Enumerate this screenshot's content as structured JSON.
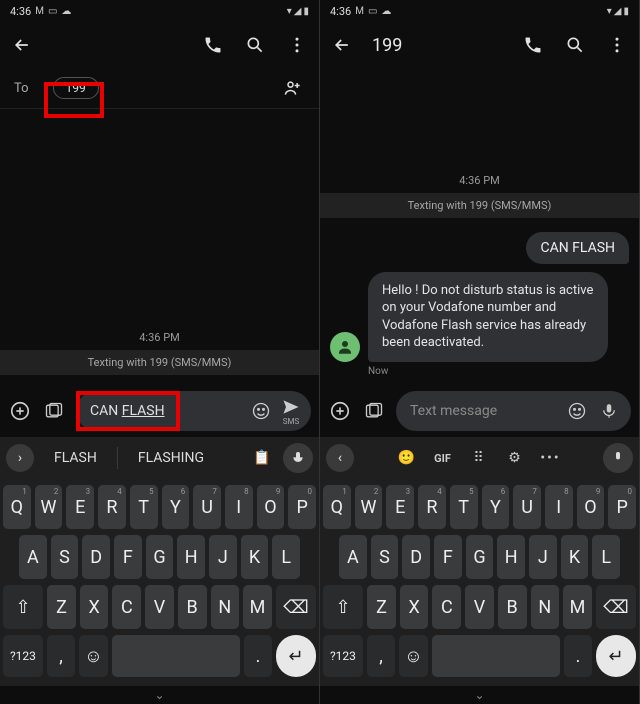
{
  "status": {
    "time": "4:36",
    "icons": [
      "M",
      "▭",
      "☁"
    ],
    "right": [
      "▾",
      "◢",
      "▮"
    ]
  },
  "left": {
    "to_label": "To",
    "chip": "199",
    "timestamp": "4:36 PM",
    "infoband": "Texting with 199 (SMS/MMS)",
    "input_prefix": "CAN ",
    "input_underlined": "FLASH",
    "send_label": "SMS",
    "suggestions": [
      "FLASH",
      "FLASHING"
    ]
  },
  "right": {
    "title": "199",
    "timestamp": "4:36 PM",
    "infoband": "Texting with 199 (SMS/MMS)",
    "msg_out": "CAN FLASH",
    "msg_in": "Hello ! Do not disturb status is  active on your Vodafone number and Vodafone Flash service has already been deactivated.",
    "msg_meta": "Now",
    "placeholder": "Text message",
    "toolbar": [
      "🙂",
      "GIF",
      "⠿",
      "⚙",
      "•••"
    ]
  },
  "keyboard": {
    "row1": [
      [
        "Q",
        "1"
      ],
      [
        "W",
        "2"
      ],
      [
        "E",
        "3"
      ],
      [
        "R",
        "4"
      ],
      [
        "T",
        "5"
      ],
      [
        "Y",
        "6"
      ],
      [
        "U",
        "7"
      ],
      [
        "I",
        "8"
      ],
      [
        "O",
        "9"
      ],
      [
        "P",
        "0"
      ]
    ],
    "row2": [
      "A",
      "S",
      "D",
      "F",
      "G",
      "H",
      "J",
      "K",
      "L"
    ],
    "row3": [
      "Z",
      "X",
      "C",
      "V",
      "B",
      "N",
      "M"
    ],
    "shift": "⇧",
    "backspace": "⌫",
    "symkey": "?123",
    "comma": ",",
    "emoji": "☺",
    "period": ".",
    "enter": "↵"
  }
}
